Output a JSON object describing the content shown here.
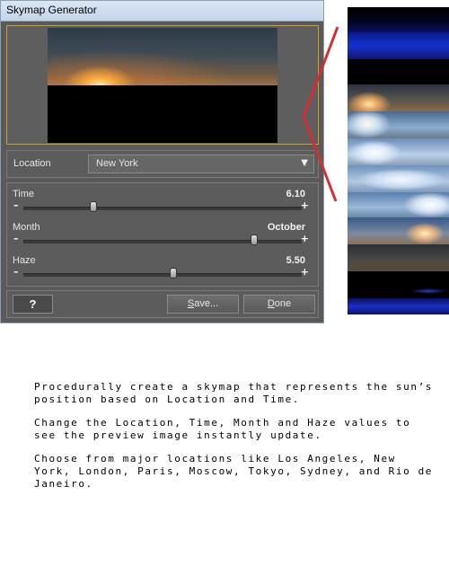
{
  "window": {
    "title": "Skymap Generator"
  },
  "location": {
    "label": "Location",
    "value": "New York",
    "arrow": "▼"
  },
  "sliders": [
    {
      "label": "Time",
      "value_text": "6.10",
      "level": 0.25
    },
    {
      "label": "Month",
      "value_text": "October",
      "level": 0.83
    },
    {
      "label": "Haze",
      "value_text": "5.50",
      "level": 0.54
    }
  ],
  "slider_symbols": {
    "minus": "–",
    "plus": "+"
  },
  "buttons": {
    "help": "?",
    "save_mnemonic": "S",
    "save_rest": "ave...",
    "done_mnemonic": "D",
    "done_rest": "one"
  },
  "caption": {
    "p1": "Procedurally create a skymap that represents the sun’s position based on Location and Time.",
    "p2": "Change the Location, Time, Month and Haze values to see the preview image instantly update.",
    "p3": "Choose from major locations like Los Angeles, New York, London, Paris, Moscow, Tokyo, Sydney, and Rio de Janeiro."
  },
  "colors": {
    "dialog_bg": "#5a5a5a",
    "preview_border": "#c9a227",
    "pointer_line": "#d23030"
  }
}
